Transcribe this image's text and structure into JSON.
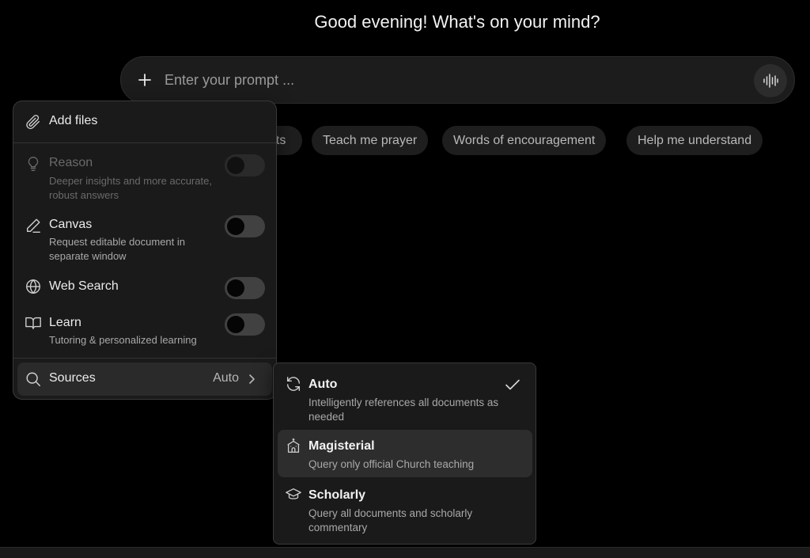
{
  "greeting": "Good evening! What's on your mind?",
  "prompt": {
    "placeholder": "Enter your prompt ...",
    "value": ""
  },
  "suggestions": [
    {
      "label": "ets"
    },
    {
      "label": "Teach me prayer"
    },
    {
      "label": "Words of encouragement"
    },
    {
      "label": "Help me understand"
    }
  ],
  "tools_menu": {
    "add_files": "Add files",
    "reason": {
      "title": "Reason",
      "desc": "Deeper insights and more accurate, robust answers",
      "enabled": false,
      "disabled": true
    },
    "canvas": {
      "title": "Canvas",
      "desc": "Request editable document in separate window",
      "enabled": false
    },
    "web_search": {
      "title": "Web Search",
      "enabled": false
    },
    "learn": {
      "title": "Learn",
      "desc": "Tutoring & personalized learning",
      "enabled": false
    },
    "sources": {
      "label": "Sources",
      "value": "Auto"
    }
  },
  "sources_menu": {
    "options": [
      {
        "title": "Auto",
        "desc": "Intelligently references all documents as needed",
        "selected": true,
        "icon": "refresh-icon"
      },
      {
        "title": "Magisterial",
        "desc": "Query only official Church teaching",
        "selected": false,
        "icon": "church-icon"
      },
      {
        "title": "Scholarly",
        "desc": "Query all documents and scholarly commentary",
        "selected": false,
        "icon": "graduation-cap-icon"
      }
    ]
  }
}
